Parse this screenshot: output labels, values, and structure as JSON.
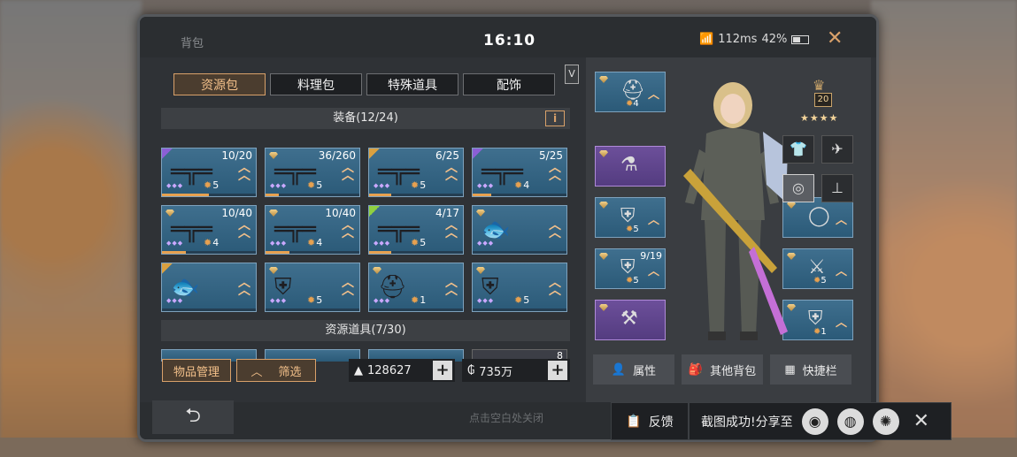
{
  "window": {
    "title": "背包",
    "clock": "16:10",
    "ping": "112ms",
    "battery": "42%"
  },
  "tabs": [
    {
      "label": "资源包",
      "active": true
    },
    {
      "label": "料理包",
      "active": false
    },
    {
      "label": "特殊道具",
      "active": false
    },
    {
      "label": "配饰",
      "active": false
    }
  ],
  "v_badge": "V",
  "equipment_section": {
    "title": "装备(12/24)",
    "info_icon": "i"
  },
  "resource_section": {
    "title": "资源道具(7/30)"
  },
  "items": [
    {
      "count": "10/20",
      "level": "5",
      "icon": "rifle-icon",
      "tag": "purple",
      "progress": 0.5
    },
    {
      "count": "36/260",
      "level": "5",
      "icon": "rifle-icon",
      "tag": "none",
      "progress": 0.14
    },
    {
      "count": "6/25",
      "level": "5",
      "icon": "rifle-icon",
      "tag": "gold",
      "progress": 0.24
    },
    {
      "count": "5/25",
      "level": "4",
      "icon": "rifle-icon",
      "tag": "purple",
      "progress": 0.2
    },
    {
      "count": "10/40",
      "level": "4",
      "icon": "rifle-icon",
      "tag": "none",
      "progress": 0.25
    },
    {
      "count": "10/40",
      "level": "4",
      "icon": "rifle-icon",
      "tag": "none",
      "progress": 0.25
    },
    {
      "count": "4/17",
      "level": "5",
      "icon": "rifle-icon",
      "tag": "green",
      "progress": 0.24
    },
    {
      "count": "",
      "level": "",
      "icon": "fish-icon",
      "tag": "none",
      "progress": 0.0
    },
    {
      "count": "",
      "level": "",
      "icon": "fish-icon",
      "tag": "gold",
      "progress": 0.0
    },
    {
      "count": "",
      "level": "5",
      "icon": "armor-icon",
      "tag": "none",
      "progress": 0.0
    },
    {
      "count": "",
      "level": "1",
      "icon": "helmet-icon",
      "tag": "none",
      "progress": 0.0
    },
    {
      "count": "",
      "level": "5",
      "icon": "armor-icon",
      "tag": "none",
      "progress": 0.0
    }
  ],
  "resource_row": [
    {
      "count": ""
    },
    {
      "count": ""
    },
    {
      "count": ""
    },
    {
      "count": "8"
    }
  ],
  "buttons": {
    "manage": "物品管理",
    "filter": "筛选"
  },
  "currency": [
    {
      "icon": "crystal-icon",
      "value": "128627"
    },
    {
      "icon": "coin-icon",
      "value": "735万"
    }
  ],
  "equipment_slots_left": [
    {
      "level": "4",
      "count": "",
      "icon": "helmet-icon",
      "color": "blue"
    },
    {
      "level": "",
      "count": "",
      "icon": "spray-icon",
      "color": "purple"
    },
    {
      "level": "5",
      "count": "",
      "icon": "armor-icon",
      "color": "blue"
    },
    {
      "level": "5",
      "count": "9/19",
      "icon": "armor-icon",
      "color": "blue"
    },
    {
      "level": "",
      "count": "",
      "icon": "tool-icon",
      "color": "purple"
    }
  ],
  "equipment_slots_right": [
    {
      "level": "",
      "count": "",
      "icon": "ring-icon",
      "color": "blue"
    },
    {
      "level": "5",
      "count": "",
      "icon": "blade-icon",
      "color": "blue"
    },
    {
      "level": "1",
      "count": "",
      "icon": "backpack-icon",
      "color": "blue"
    }
  ],
  "rank": {
    "level": "20",
    "stars": "★★★★"
  },
  "bottom_tabs": [
    {
      "label": "属性",
      "icon": "person-icon"
    },
    {
      "label": "其他背包",
      "icon": "bag-icon"
    },
    {
      "label": "快捷栏",
      "icon": "grid-icon"
    }
  ],
  "footer": {
    "hint": "点击空白处关闭"
  },
  "share_bar": {
    "feedback": "反馈",
    "message": "截图成功!分享至"
  }
}
